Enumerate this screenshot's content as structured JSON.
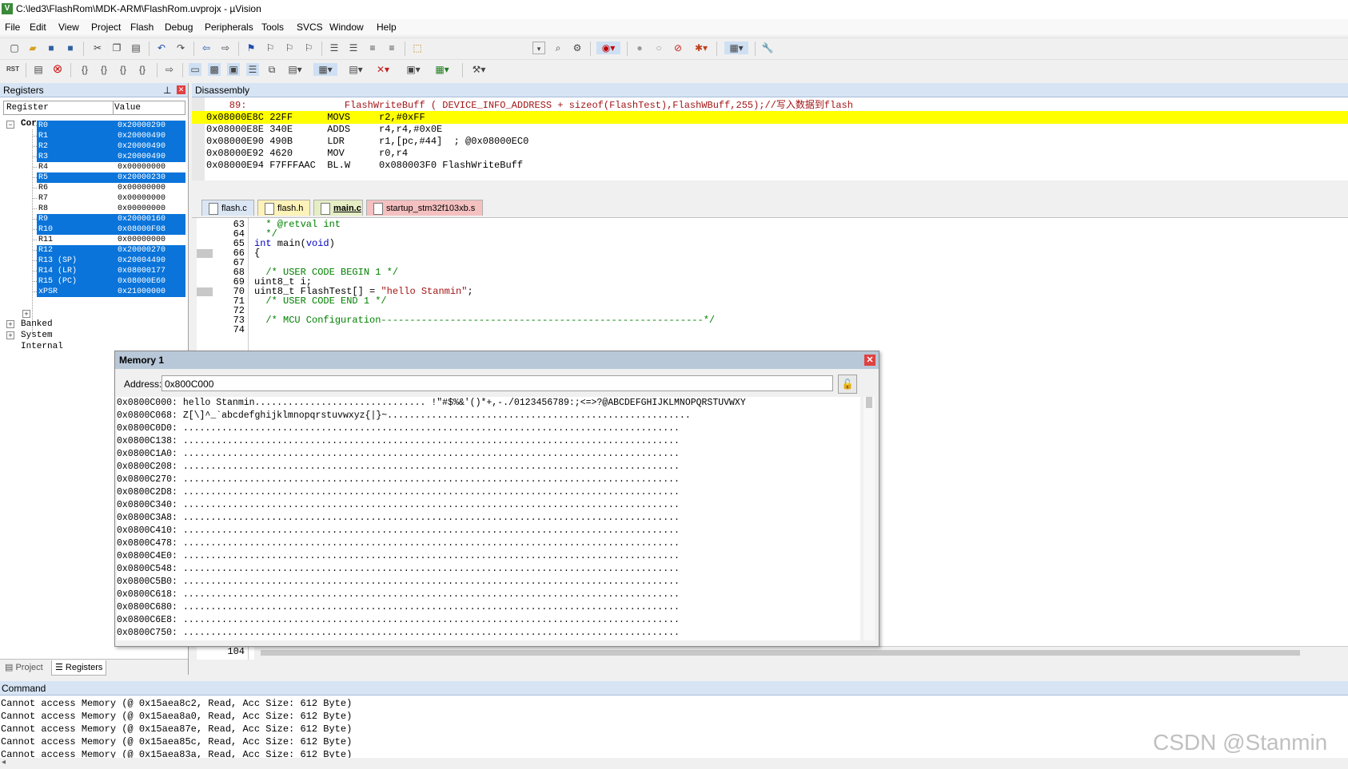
{
  "window": {
    "title": "C:\\led3\\FlashRom\\MDK-ARM\\FlashRom.uvprojx - µVision",
    "app_icon": "V"
  },
  "menu": [
    "File",
    "Edit",
    "View",
    "Project",
    "Flash",
    "Debug",
    "Peripherals",
    "Tools",
    "SVCS",
    "Window",
    "Help"
  ],
  "toolbar": {
    "rst_label": "RST"
  },
  "registers": {
    "pane_title": "Registers",
    "col_register": "Register",
    "col_value": "Value",
    "core_label": "Core",
    "rows": [
      {
        "name": "R0",
        "value": "0x20000290",
        "selected": true
      },
      {
        "name": "R1",
        "value": "0x20000490",
        "selected": true
      },
      {
        "name": "R2",
        "value": "0x20000490",
        "selected": true
      },
      {
        "name": "R3",
        "value": "0x20000490",
        "selected": true
      },
      {
        "name": "R4",
        "value": "0x00000000",
        "selected": false
      },
      {
        "name": "R5",
        "value": "0x20000230",
        "selected": true
      },
      {
        "name": "R6",
        "value": "0x00000000",
        "selected": false
      },
      {
        "name": "R7",
        "value": "0x00000000",
        "selected": false
      },
      {
        "name": "R8",
        "value": "0x00000000",
        "selected": false
      },
      {
        "name": "R9",
        "value": "0x20000160",
        "selected": true
      },
      {
        "name": "R10",
        "value": "0x08000F08",
        "selected": true
      },
      {
        "name": "R11",
        "value": "0x00000000",
        "selected": false
      },
      {
        "name": "R12",
        "value": "0x20000270",
        "selected": true
      },
      {
        "name": "R13 (SP)",
        "value": "0x20004490",
        "selected": true
      },
      {
        "name": "R14 (LR)",
        "value": "0x08000177",
        "selected": true
      },
      {
        "name": "R15 (PC)",
        "value": "0x08000E60",
        "selected": true
      },
      {
        "name": "xPSR",
        "value": "0x21000000",
        "selected": true
      }
    ],
    "groups": [
      "Banked",
      "System",
      "Internal"
    ],
    "tabs": [
      "Project",
      "Registers"
    ]
  },
  "disassembly": {
    "title": "Disassembly",
    "source_line": "    89:                 FlashWriteBuff ( DEVICE_INFO_ADDRESS + sizeof(FlashTest),FlashWBuff,255);//写入数据到flash",
    "lines": [
      {
        "text": "0x08000E8C 22FF      MOVS     r2,#0xFF",
        "highlight": true
      },
      {
        "text": "0x08000E8E 340E      ADDS     r4,r4,#0x0E",
        "highlight": false
      },
      {
        "text": "0x08000E90 490B      LDR      r1,[pc,#44]  ; @0x08000EC0",
        "highlight": false
      },
      {
        "text": "0x08000E92 4620      MOV      r0,r4",
        "highlight": false
      },
      {
        "text": "0x08000E94 F7FFFAAC  BL.W     0x080003F0 FlashWriteBuff",
        "highlight": false
      }
    ]
  },
  "editor": {
    "tabs": [
      {
        "label": "flash.c",
        "color": "#dbe6f4",
        "active": false
      },
      {
        "label": "flash.h",
        "color": "#fdf2b8",
        "active": false
      },
      {
        "label": "main.c",
        "color": "#e4edc4",
        "active": true
      },
      {
        "label": "startup_stm32f103xb.s",
        "color": "#f4c0c0",
        "active": false
      }
    ],
    "lines": [
      {
        "n": "63",
        "code": "  * @retval int",
        "cls": "cm"
      },
      {
        "n": "64",
        "code": "  */",
        "cls": "cm"
      },
      {
        "n": "65",
        "code": "int main(void)",
        "cls": ""
      },
      {
        "n": "66",
        "code": "{",
        "cls": ""
      },
      {
        "n": "67",
        "code": "",
        "cls": ""
      },
      {
        "n": "68",
        "code": "  /* USER CODE BEGIN 1 */",
        "cls": "cm"
      },
      {
        "n": "69",
        "code": "uint8_t i;",
        "cls": ""
      },
      {
        "n": "70",
        "code": "uint8_t FlashTest[] = \"hello Stanmin\";",
        "cls": ""
      },
      {
        "n": "71",
        "code": "  /* USER CODE END 1 */",
        "cls": "cm"
      },
      {
        "n": "72",
        "code": "",
        "cls": ""
      },
      {
        "n": "73",
        "code": "  /* MCU Configuration--------------------------------------------------------*/",
        "cls": "cm"
      },
      {
        "n": "74",
        "code": "",
        "cls": ""
      }
    ],
    "bottom_line_number": "104"
  },
  "memory": {
    "title": "Memory 1",
    "address_label": "Address:",
    "address_value": "0x800C000",
    "rows": [
      "0x0800C000: hello Stanmin............................... !\"#$%&'()*+,-./0123456789:;<=>?@ABCDEFGHIJKLMNOPQRSTUVWXY",
      "0x0800C068: Z[\\]^_`abcdefghijklmnopqrstuvwxyz{|}~.......................................................",
      "0x0800C0D0: ..........................................................................................",
      "0x0800C138: ..........................................................................................",
      "0x0800C1A0: ..........................................................................................",
      "0x0800C208: ..........................................................................................",
      "0x0800C270: ..........................................................................................",
      "0x0800C2D8: ..........................................................................................",
      "0x0800C340: ..........................................................................................",
      "0x0800C3A8: ..........................................................................................",
      "0x0800C410: ..........................................................................................",
      "0x0800C478: ..........................................................................................",
      "0x0800C4E0: ..........................................................................................",
      "0x0800C548: ..........................................................................................",
      "0x0800C5B0: ..........................................................................................",
      "0x0800C618: ..........................................................................................",
      "0x0800C680: ..........................................................................................",
      "0x0800C6E8: ..........................................................................................",
      "0x0800C750: .........................................................................................."
    ]
  },
  "command": {
    "title": "Command",
    "lines": [
      "Cannot access Memory (@ 0x15aea8c2, Read, Acc Size: 612 Byte)",
      "Cannot access Memory (@ 0x15aea8a0, Read, Acc Size: 612 Byte)",
      "Cannot access Memory (@ 0x15aea87e, Read, Acc Size: 612 Byte)",
      "Cannot access Memory (@ 0x15aea85c, Read, Acc Size: 612 Byte)",
      "Cannot access Memory (@ 0x15aea83a, Read, Acc Size: 612 Byte)"
    ]
  },
  "watermark": "CSDN @Stanmin",
  "colors": {
    "selection": "#0a74da",
    "highlight": "#ffff00",
    "pane_header": "#d6e4f4"
  }
}
